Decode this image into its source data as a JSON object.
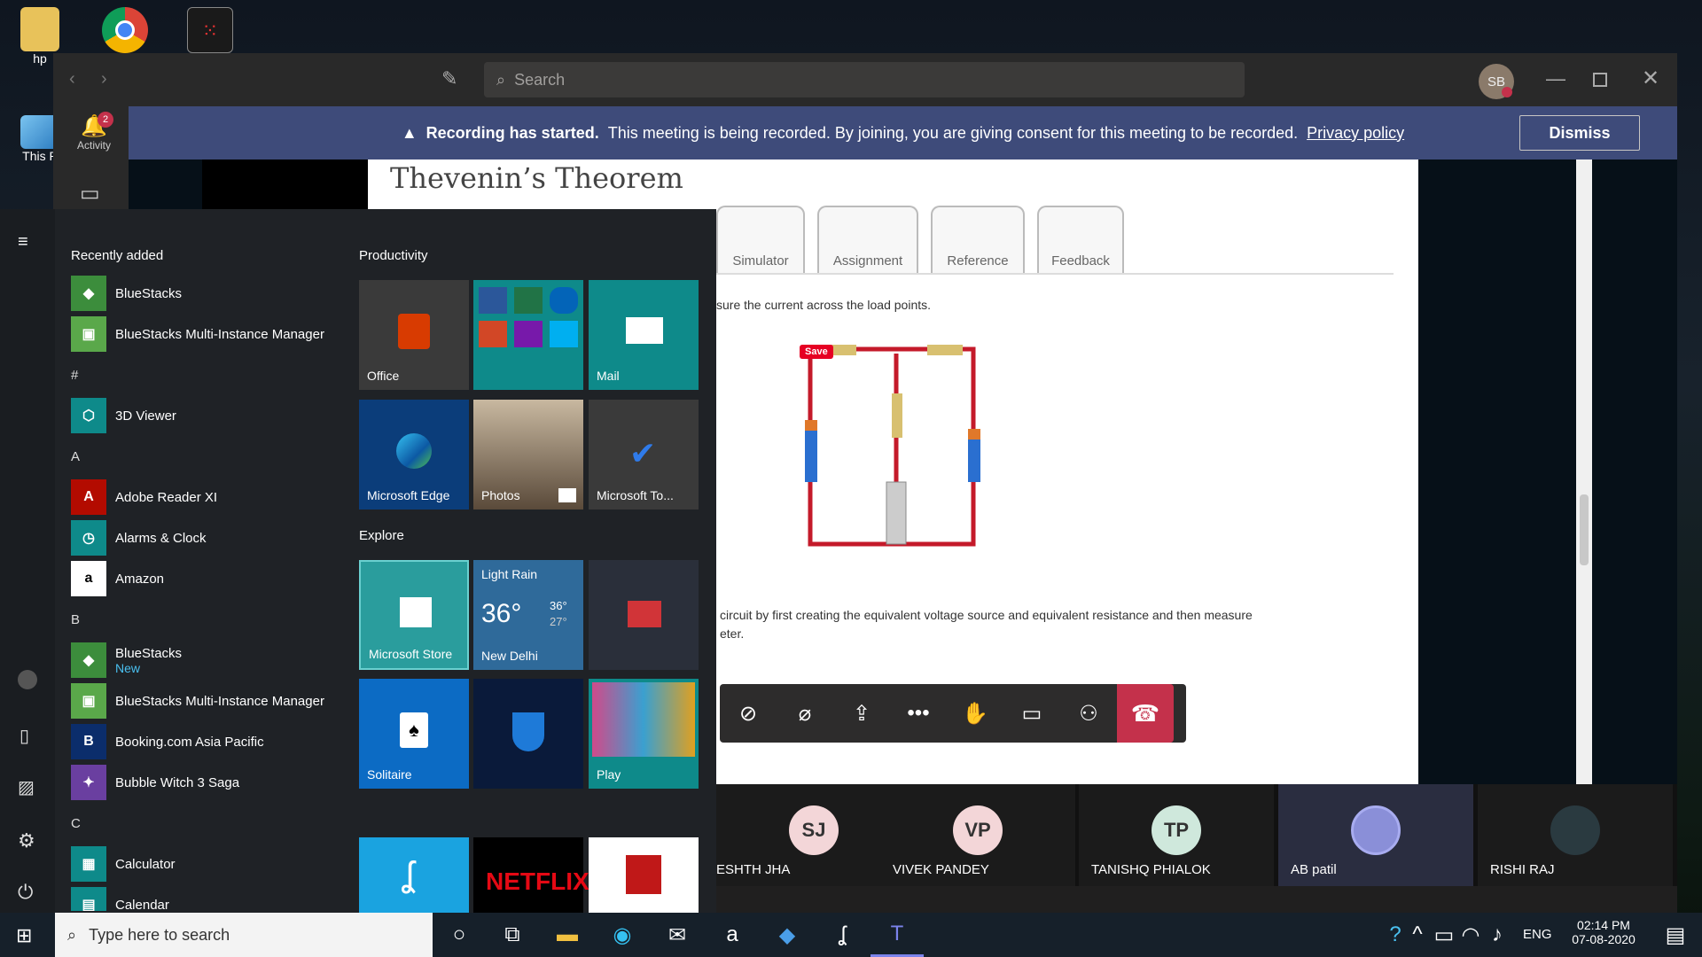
{
  "desktop": {
    "icons": [
      {
        "label": "hp",
        "icon": "folder-user-icon"
      },
      {
        "label": "",
        "icon": "chrome-icon"
      },
      {
        "label": "",
        "icon": "dots-app-icon"
      },
      {
        "label": "This P",
        "icon": "this-pc-icon"
      }
    ]
  },
  "teams": {
    "search_placeholder": "Search",
    "user_initials": "SB",
    "rail": {
      "activity_label": "Activity",
      "activity_badge": "2",
      "chat_label": "Chat"
    },
    "banner": {
      "bold": "Recording has started.",
      "text": "This meeting is being recorded. By joining, you are giving consent for this meeting to be recorded.",
      "link": "Privacy policy",
      "dismiss": "Dismiss"
    },
    "shared": {
      "title": "Thevenin’s Theorem",
      "tabs": [
        "Simulator",
        "Assignment",
        "Reference",
        "Feedback"
      ],
      "line1": "sure the current across the load points.",
      "save_badge": "Save",
      "line2": "circuit by first creating the equivalent voltage source and equivalent resistance and then measure",
      "line3": "eter."
    },
    "participants": [
      {
        "initials": "SJ",
        "name": "ESHTH JHA",
        "color": "#f3d6d8"
      },
      {
        "initials": "VP",
        "name": "VIVEK PANDEY",
        "color": "#f3d6d8"
      },
      {
        "initials": "TP",
        "name": "TANISHQ PHIALOK",
        "color": "#cfe8dc"
      },
      {
        "initials": "",
        "name": "AB patil",
        "color": "#8a8fd8"
      },
      {
        "initials": "",
        "name": "RISHI RAJ",
        "color": "#2a3a40"
      }
    ]
  },
  "start_menu": {
    "recently_added": "Recently added",
    "apps": [
      {
        "type": "app",
        "label": "BlueStacks",
        "icon_color": "#3c8d3c",
        "glyph": "◆"
      },
      {
        "type": "app",
        "label": "BlueStacks Multi-Instance Manager",
        "icon_color": "#5aa84a",
        "glyph": "▣"
      },
      {
        "type": "letter",
        "label": "#"
      },
      {
        "type": "app",
        "label": "3D Viewer",
        "icon_color": "#0e8a8a",
        "glyph": "⬡"
      },
      {
        "type": "letter",
        "label": "A"
      },
      {
        "type": "app",
        "label": "Adobe Reader XI",
        "icon_color": "#b30b00",
        "glyph": "A"
      },
      {
        "type": "app",
        "label": "Alarms & Clock",
        "icon_color": "#0e8a8a",
        "glyph": "◷"
      },
      {
        "type": "app",
        "label": "Amazon",
        "icon_color": "#ffffff",
        "glyph": "a"
      },
      {
        "type": "letter",
        "label": "B"
      },
      {
        "type": "app2",
        "label": "BlueStacks",
        "sub": "New",
        "icon_color": "#3c8d3c",
        "glyph": "◆"
      },
      {
        "type": "app",
        "label": "BlueStacks Multi-Instance Manager",
        "icon_color": "#5aa84a",
        "glyph": "▣"
      },
      {
        "type": "app",
        "label": "Booking.com Asia Pacific",
        "icon_color": "#0b2d6b",
        "glyph": "B"
      },
      {
        "type": "app",
        "label": "Bubble Witch 3 Saga",
        "icon_color": "#6a3fa0",
        "glyph": "✦"
      },
      {
        "type": "letter",
        "label": "C"
      },
      {
        "type": "app",
        "label": "Calculator",
        "icon_color": "#0e8a8a",
        "glyph": "▦"
      },
      {
        "type": "app",
        "label": "Calendar",
        "icon_color": "#0e8a8a",
        "glyph": "▤"
      }
    ],
    "productivity": "Productivity",
    "explore": "Explore",
    "tiles": {
      "office": "Office",
      "mail": "Mail",
      "edge": "Microsoft Edge",
      "photos": "Photos",
      "todo": "Microsoft To...",
      "store": "Microsoft Store",
      "weather_cond": "Light Rain",
      "weather_temp": "36°",
      "weather_hi": "36°",
      "weather_lo": "27°",
      "weather_city": "New Delhi",
      "solitaire": "Solitaire",
      "play": "Play",
      "netflix": "NETFLIX"
    }
  },
  "taskbar": {
    "search_placeholder": "Type here to search",
    "lang": "ENG",
    "time": "02:14 PM",
    "date": "07-08-2020"
  }
}
